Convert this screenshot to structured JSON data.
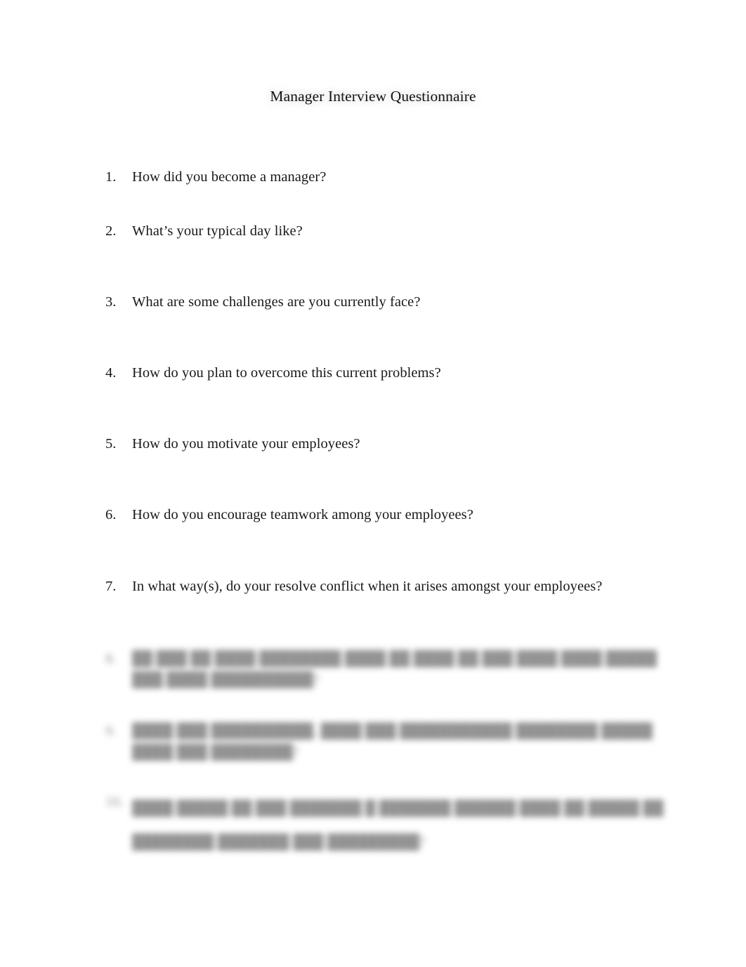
{
  "document": {
    "title": "Manager Interview Questionnaire",
    "background_color": "#ffffff",
    "text_color": "#191919",
    "blurred_text_color": "#8a8a8a"
  },
  "questions": [
    {
      "number": "1.",
      "text": "How did you become a manager?",
      "legible": true
    },
    {
      "number": "2.",
      "text": "What’s your typical day like?",
      "legible": true
    },
    {
      "number": "3.",
      "text": "What are some challenges are you currently face?",
      "legible": true
    },
    {
      "number": "4.",
      "text": "How do you plan to overcome this current problems?",
      "legible": true
    },
    {
      "number": "5.",
      "text": "How do you motivate your employees?",
      "legible": true
    },
    {
      "number": "6.",
      "text": "How do you encourage teamwork among your employees?",
      "legible": true
    },
    {
      "number": "7.",
      "text": "In what way(s), do your resolve conflict when it arises amongst your employees?",
      "legible": true
    },
    {
      "number": "8.",
      "text": "██ ███ ██ ████ ████████ ████ ██ ████ ██ ███ ████ ████ █████ ███ ████ ██████████?",
      "legible": false
    },
    {
      "number": "9.",
      "text": "████ ███ ██████████, ████ ███ ███████████ ████████ █████ ████ ███ ████████?",
      "legible": false
    },
    {
      "number": "10.",
      "text": "████ █████ ██ ███ ███████ █ ███████ ██████ ████ ██ █████ ██ ████████ ███████ ███ █████████?",
      "legible": false
    }
  ]
}
